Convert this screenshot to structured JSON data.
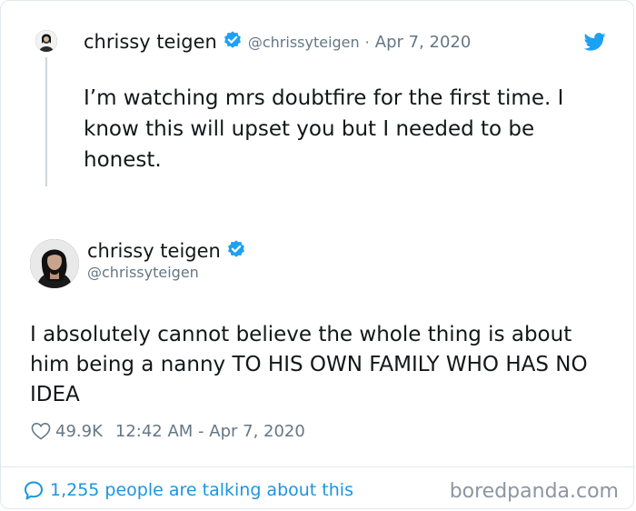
{
  "colors": {
    "text": "#14171a",
    "muted": "#657786",
    "link": "#1b95e0",
    "verified": "#1da1f2",
    "border": "#e1e8ed"
  },
  "icons": {
    "verified": "verified-badge-icon",
    "bird": "twitter-bird-icon",
    "heart": "heart-icon",
    "bubble": "speech-bubble-icon"
  },
  "parent_tweet": {
    "name": "chrissy teigen",
    "handle": "@chrissyteigen",
    "separator": "·",
    "date": "Apr 7, 2020",
    "text": "I’m watching mrs doubtfire for the first time. I know this will upset you but I needed to be honest."
  },
  "main_tweet": {
    "name": "chrissy teigen",
    "handle": "@chrissyteigen",
    "text": "I absolutely cannot believe the whole thing is about him being a nanny TO HIS OWN FAMILY WHO HAS NO IDEA",
    "likes": "49.9K",
    "timestamp": "12:42 AM - Apr 7, 2020"
  },
  "footer": {
    "talking_label": "1,255 people are talking about this",
    "watermark": "boredpanda.com"
  }
}
